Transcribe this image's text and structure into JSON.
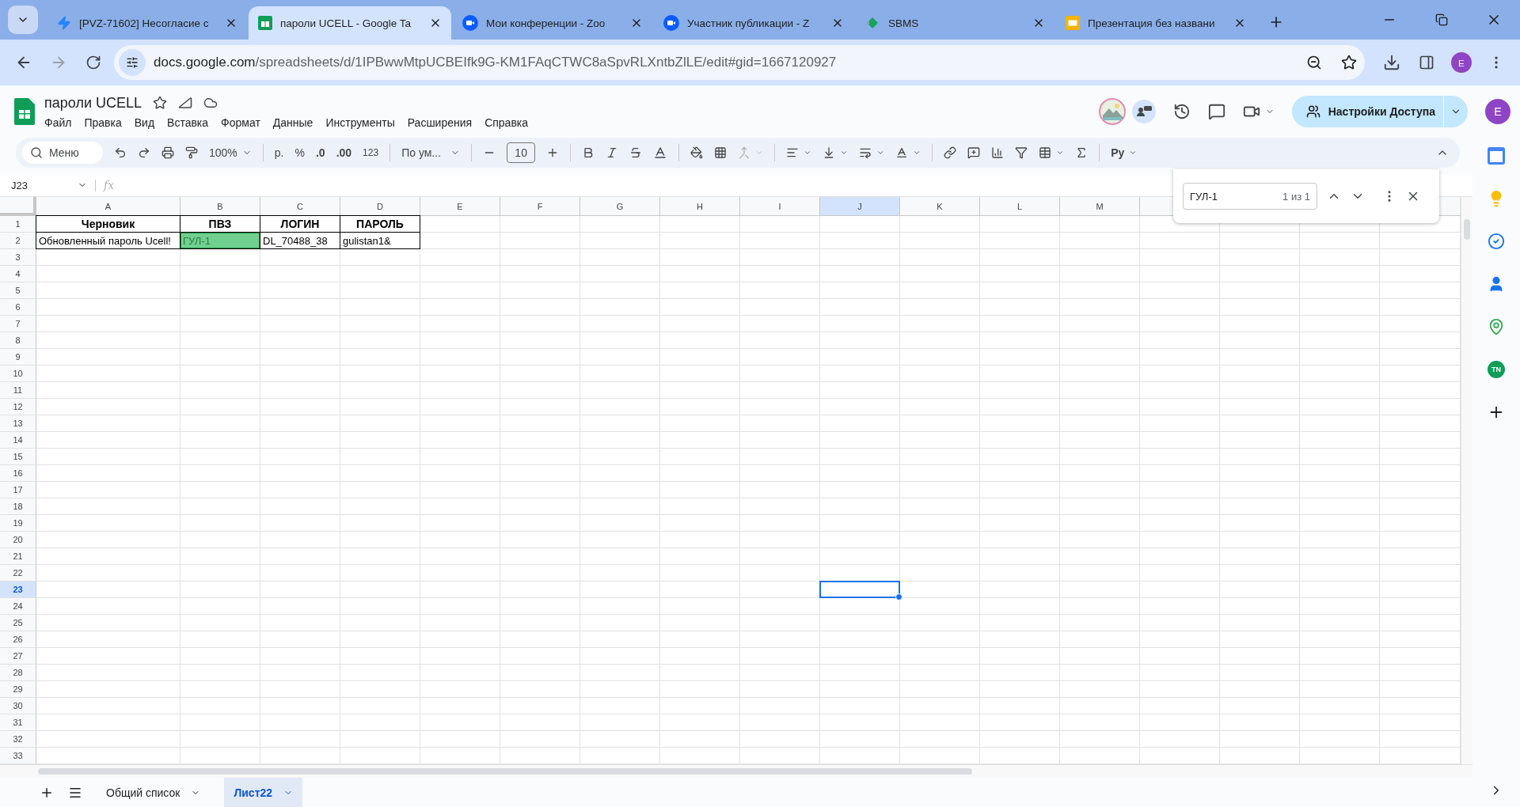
{
  "browser_tabs": [
    {
      "kind": "jira",
      "title": "[PVZ-71602] Несогласие с",
      "selected": false
    },
    {
      "kind": "sheets",
      "title": "пароли UCELL - Google Ta",
      "selected": true
    },
    {
      "kind": "zoom",
      "title": "Мои конференции - Zoo",
      "selected": false
    },
    {
      "kind": "zoom",
      "title": "Участник публикации - Z",
      "selected": false
    },
    {
      "kind": "sbms",
      "title": "SBMS",
      "selected": false
    },
    {
      "kind": "slides",
      "title": "Презентация без названи",
      "selected": false
    }
  ],
  "address_bar": {
    "host": "docs.google.com",
    "path": "/spreadsheets/d/1IPBwwMtpUCBEIfk9G-KM1FAqCTWC8aSpvRLXntbZlLE/edit#gid=1667120927"
  },
  "profile_initial": "E",
  "document": {
    "title": "пароли UCELL",
    "menu": [
      "Файл",
      "Правка",
      "Вид",
      "Вставка",
      "Формат",
      "Данные",
      "Инструменты",
      "Расширения",
      "Справка"
    ],
    "share_button": "Настройки Доступа",
    "account_initial": "E"
  },
  "toolbar": {
    "menu_search": "Меню",
    "zoom": "100%",
    "currency": "р.",
    "percent": "%",
    "decrease_decimals": ".0",
    "increase_decimals": ".00",
    "number_format": "123",
    "font": "По ум...",
    "font_size": "10",
    "input_tools": "Ру"
  },
  "formula_bar": {
    "name_box": "J23",
    "fx": "fx"
  },
  "find_box": {
    "query": "ГУЛ-1",
    "result": "1 из 1"
  },
  "columns": [
    {
      "label": "A",
      "selected": false
    },
    {
      "label": "B",
      "selected": false
    },
    {
      "label": "C",
      "selected": false
    },
    {
      "label": "D",
      "selected": false
    },
    {
      "label": "E",
      "selected": false
    },
    {
      "label": "F",
      "selected": false
    },
    {
      "label": "G",
      "selected": false
    },
    {
      "label": "H",
      "selected": false
    },
    {
      "label": "I",
      "selected": false
    },
    {
      "label": "J",
      "selected": true
    },
    {
      "label": "K",
      "selected": false
    },
    {
      "label": "L",
      "selected": false
    },
    {
      "label": "M",
      "selected": false
    }
  ],
  "rows": [
    {
      "number": "1",
      "selected": false,
      "kind": "header",
      "cells": [
        {
          "text": "Черновик",
          "highlighted": false
        },
        {
          "text": "ПВЗ",
          "highlighted": false
        },
        {
          "text": "ЛОГИН",
          "highlighted": false
        },
        {
          "text": "ПАРОЛЬ",
          "highlighted": false
        }
      ]
    },
    {
      "number": "2",
      "selected": false,
      "kind": "data",
      "cells": [
        {
          "text": "Обновленный пароль Ucell!",
          "highlighted": false
        },
        {
          "text": "ГУЛ-1",
          "highlighted": true
        },
        {
          "text": "DL_70488_38",
          "highlighted": false
        },
        {
          "text": "gulistan1&",
          "highlighted": false
        }
      ]
    },
    {
      "number": "3",
      "selected": false
    },
    {
      "number": "4",
      "selected": false
    },
    {
      "number": "5",
      "selected": false
    },
    {
      "number": "6",
      "selected": false
    },
    {
      "number": "7",
      "selected": false
    },
    {
      "number": "8",
      "selected": false
    },
    {
      "number": "9",
      "selected": false
    },
    {
      "number": "10",
      "selected": false
    },
    {
      "number": "11",
      "selected": false
    },
    {
      "number": "12",
      "selected": false
    },
    {
      "number": "13",
      "selected": false
    },
    {
      "number": "14",
      "selected": false
    },
    {
      "number": "15",
      "selected": false
    },
    {
      "number": "16",
      "selected": false
    },
    {
      "number": "17",
      "selected": false
    },
    {
      "number": "18",
      "selected": false
    },
    {
      "number": "19",
      "selected": false
    },
    {
      "number": "20",
      "selected": false
    },
    {
      "number": "21",
      "selected": false
    },
    {
      "number": "22",
      "selected": false
    },
    {
      "number": "23",
      "selected": true
    },
    {
      "number": "24",
      "selected": false
    },
    {
      "number": "25",
      "selected": false
    },
    {
      "number": "26",
      "selected": false
    },
    {
      "number": "27",
      "selected": false
    },
    {
      "number": "28",
      "selected": false
    },
    {
      "number": "29",
      "selected": false
    },
    {
      "number": "30",
      "selected": false
    },
    {
      "number": "31",
      "selected": false
    },
    {
      "number": "32",
      "selected": false
    },
    {
      "number": "33",
      "selected": false
    }
  ],
  "sheet_tabs": [
    {
      "label": "Общий список",
      "selected": false
    },
    {
      "label": "Лист22",
      "selected": true
    }
  ],
  "side_panel": {
    "addon_label": "TN"
  }
}
